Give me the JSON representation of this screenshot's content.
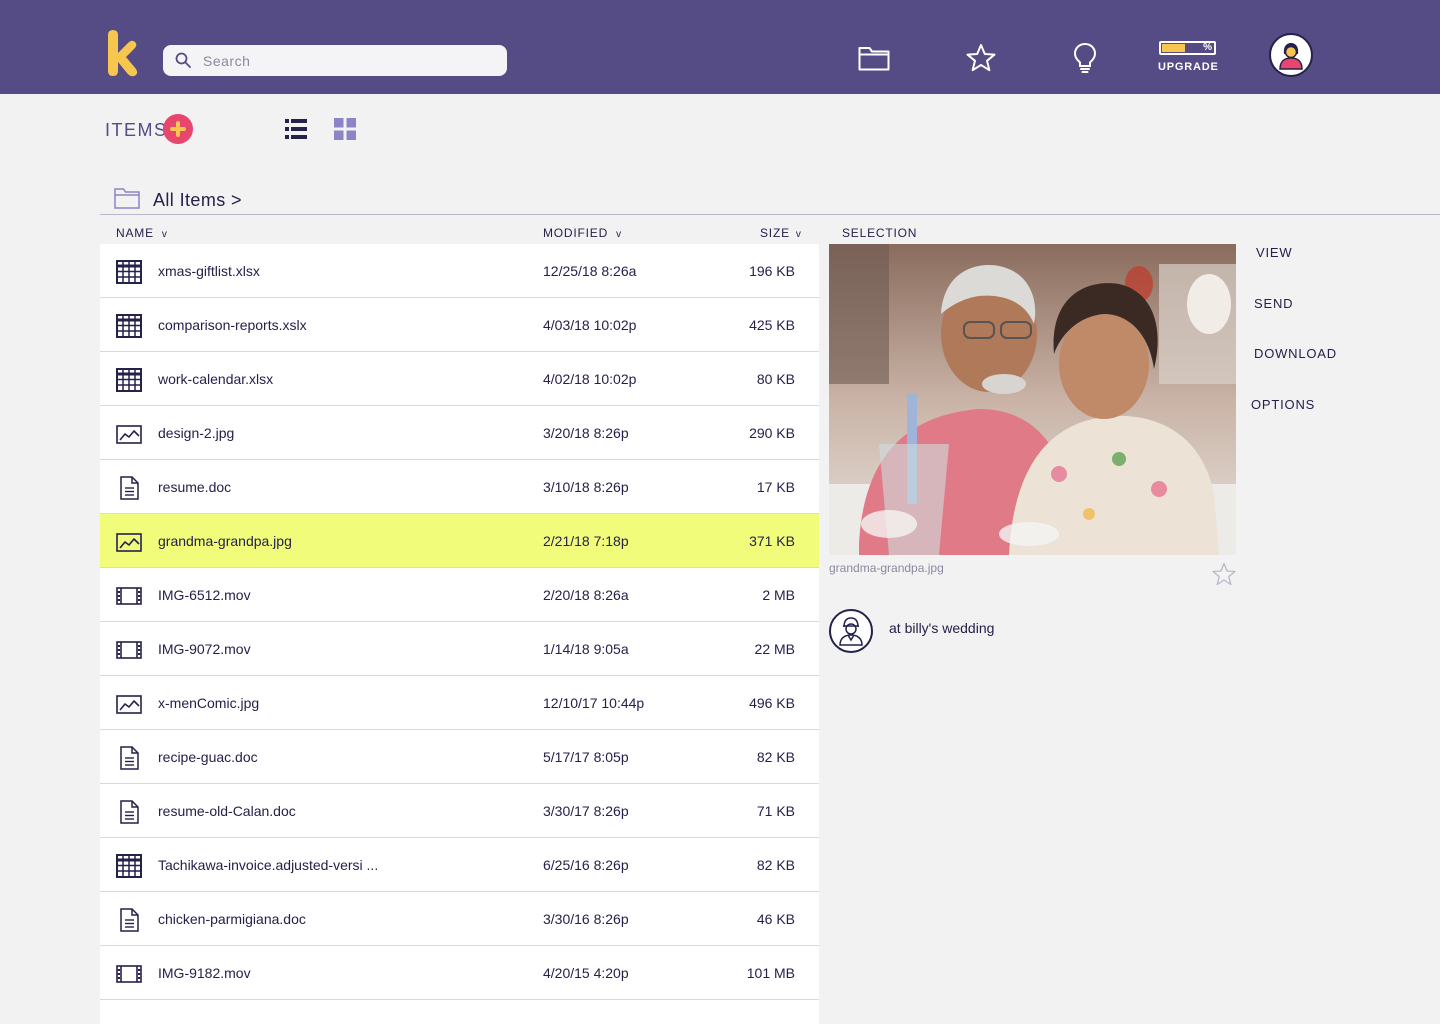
{
  "header": {
    "search_placeholder": "Search",
    "upgrade_label": "UPGRADE",
    "upgrade_percent": "%",
    "storage_used_fraction": 0.45
  },
  "items_bar": {
    "title": "ITEMS"
  },
  "breadcrumb": {
    "label": "All Items >"
  },
  "table": {
    "columns": {
      "name": "NAME",
      "modified": "MODIFIED",
      "size": "SIZE",
      "chevron": "v"
    },
    "rows": [
      {
        "name": "xmas-giftlist.xlsx",
        "modified": "12/25/18 8:26a",
        "size": "196 KB",
        "icon": "spreadsheet-icon"
      },
      {
        "name": "comparison-reports.xslx",
        "modified": "4/03/18 10:02p",
        "size": "425 KB",
        "icon": "spreadsheet-icon"
      },
      {
        "name": "work-calendar.xlsx",
        "modified": "4/02/18 10:02p",
        "size": "80 KB",
        "icon": "spreadsheet-icon"
      },
      {
        "name": "design-2.jpg",
        "modified": "3/20/18 8:26p",
        "size": "290 KB",
        "icon": "image-icon"
      },
      {
        "name": "resume.doc",
        "modified": "3/10/18 8:26p",
        "size": "17 KB",
        "icon": "document-icon"
      },
      {
        "name": "grandma-grandpa.jpg",
        "modified": "2/21/18 7:18p",
        "size": "371 KB",
        "icon": "image-icon",
        "selected": true
      },
      {
        "name": "IMG-6512.mov",
        "modified": "2/20/18 8:26a",
        "size": "2 MB",
        "icon": "video-icon"
      },
      {
        "name": "IMG-9072.mov",
        "modified": "1/14/18 9:05a",
        "size": "22 MB",
        "icon": "video-icon"
      },
      {
        "name": "x-menComic.jpg",
        "modified": "12/10/17 10:44p",
        "size": "496 KB",
        "icon": "image-icon"
      },
      {
        "name": "recipe-guac.doc",
        "modified": "5/17/17 8:05p",
        "size": "82 KB",
        "icon": "document-icon"
      },
      {
        "name": "resume-old-Calan.doc",
        "modified": "3/30/17 8:26p",
        "size": "71 KB",
        "icon": "document-icon"
      },
      {
        "name": "Tachikawa-invoice.adjusted-versi ...",
        "modified": "6/25/16 8:26p",
        "size": "82 KB",
        "icon": "spreadsheet-icon"
      },
      {
        "name": "chicken-parmigiana.doc",
        "modified": "3/30/16 8:26p",
        "size": "46 KB",
        "icon": "document-icon"
      },
      {
        "name": "IMG-9182.mov",
        "modified": "4/20/15 4:20p",
        "size": "101 MB",
        "icon": "video-icon"
      }
    ]
  },
  "selection": {
    "header": "SELECTION",
    "caption": "grandma-grandpa.jpg",
    "note": "at billy's wedding",
    "actions": {
      "view": "VIEW",
      "send": "SEND",
      "download": "DOWNLOAD",
      "options": "OPTIONS"
    }
  },
  "colors": {
    "header_bg": "#554c85",
    "accent_yellow": "#f7c64f",
    "accent_pink": "#e8466c",
    "selected_row": "#f0fc7a",
    "text_dark": "#24214a"
  }
}
